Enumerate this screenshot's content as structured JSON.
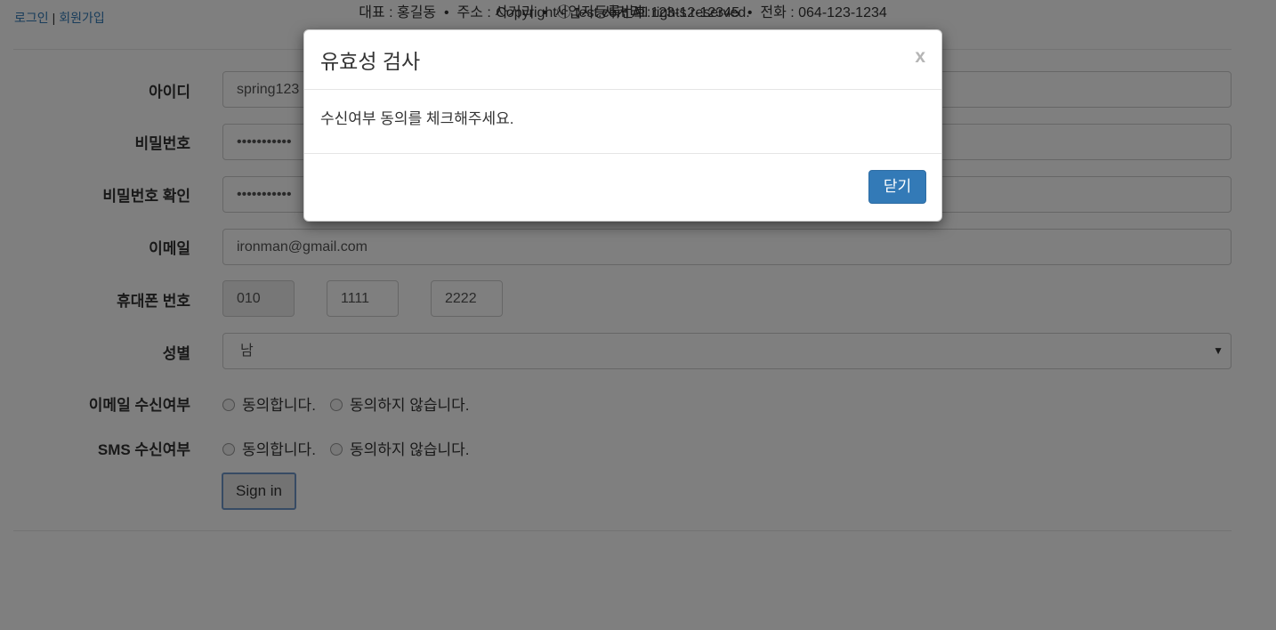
{
  "topnav": {
    "login": "로그인",
    "separator": "|",
    "signup": "회원가입"
  },
  "form": {
    "id_label": "아이디",
    "id_value": "spring123",
    "password_label": "비밀번호",
    "password_value": "•••••••••••",
    "password_confirm_label": "비밀번호 확인",
    "password_confirm_value": "•••••••••••",
    "email_label": "이메일",
    "email_value": "ironman@gmail.com",
    "phone_label": "휴대폰 번호",
    "phone_prefix": "010",
    "phone_middle": "1111",
    "phone_last": "2222",
    "gender_label": "성별",
    "gender_value": "남",
    "gender_caret": "▼",
    "email_consent_label": "이메일 수신여부",
    "sms_consent_label": "SMS 수신여부",
    "agree": "동의합니다.",
    "disagree": "동의하지 않습니다.",
    "submit": "Sign in"
  },
  "footer": {
    "company": "사거리",
    "info": "대표 : 홍길동  •  주소 : 사거리  •  사업자등록번호:123-12-12345  •  전화 : 064-123-1234",
    "copyright": "Copyrightⓒ test.com All rights reserved."
  },
  "modal": {
    "title": "유효성 검사",
    "close_x": "x",
    "message": "수신여부 동의를 체크해주세요.",
    "close_button": "닫기"
  },
  "colors": {
    "primary": "#337ab7",
    "overlay": "rgba(0,0,0,0.5)"
  }
}
